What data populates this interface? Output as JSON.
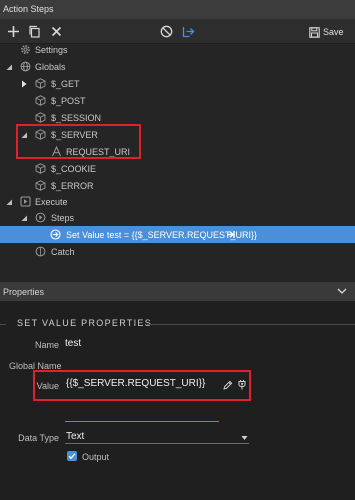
{
  "window": {
    "title": "Action Steps"
  },
  "toolbar": {
    "save_label": "Save"
  },
  "tree": {
    "settings": "Settings",
    "globals": "Globals",
    "get": "$_GET",
    "post": "$_POST",
    "session": "$_SESSION",
    "server": "$_SERVER",
    "request_uri": "REQUEST_URI",
    "cookie": "$_COOKIE",
    "error": "$_ERROR",
    "execute": "Execute",
    "steps": "Steps",
    "selected_step": "Set Value test = {{$_SERVER.REQUEST_URI}}",
    "catch": "Catch"
  },
  "properties": {
    "header": "Properties",
    "section_title": "SET VALUE PROPERTIES",
    "name_label": "Name",
    "name_value": "test",
    "global_name_label": "Global Name",
    "value_label": "Value",
    "value_value": "{{$_SERVER.REQUEST_URI}}",
    "data_type_label": "Data Type",
    "data_type_value": "Text",
    "output_label": "Output"
  },
  "colors": {
    "accent": "#4a8fd7",
    "highlight": "#e0202a",
    "background": "#252526"
  }
}
